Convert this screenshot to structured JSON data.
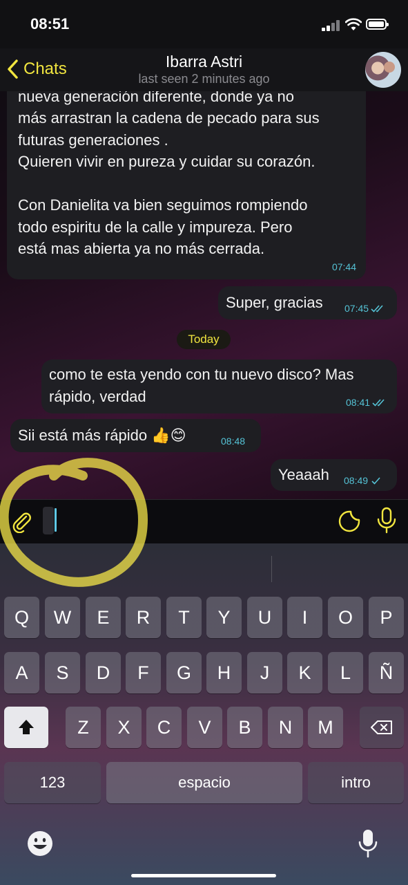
{
  "status": {
    "time": "08:51"
  },
  "header": {
    "back_label": "Chats",
    "title": "Ibarra Astri",
    "subtitle": "last seen 2 minutes ago"
  },
  "messages": [
    {
      "dir": "in",
      "text": "tocó lo que predicaste, quieran ser una\nnueva generación diferente, donde ya no\nmás arrastran la cadena de pecado para sus\nfuturas generaciones .\nQuieren vivir en pureza y cuidar su corazón.\n\nCon Danielita va bien seguimos rompiendo\ntodo espiritu de la calle y impureza. Pero\nestá mas abierta ya no más cerrada.",
      "time": "07:44"
    },
    {
      "dir": "out",
      "text": "Super, gracias",
      "time": "07:45",
      "read": true
    },
    {
      "dir": "out",
      "text": "como te esta yendo con tu nuevo disco? Mas\nrápido, verdad",
      "time": "08:41",
      "read": true
    },
    {
      "dir": "in",
      "text": "Sii está más rápido 👍😊",
      "time": "08:48"
    },
    {
      "dir": "out",
      "text": "Yeaaah",
      "time": "08:49",
      "read": false
    }
  ],
  "date_separator": "Today",
  "input": {
    "value": ""
  },
  "keyboard": {
    "row1": [
      "Q",
      "W",
      "E",
      "R",
      "T",
      "Y",
      "U",
      "I",
      "O",
      "P"
    ],
    "row2": [
      "A",
      "S",
      "D",
      "F",
      "G",
      "H",
      "J",
      "K",
      "L",
      "Ñ"
    ],
    "row3": [
      "Z",
      "X",
      "C",
      "V",
      "B",
      "N",
      "M"
    ],
    "numbers_label": "123",
    "space_label": "espacio",
    "return_label": "intro"
  },
  "icons": {
    "back": "chevron-left-icon",
    "attach": "paperclip-icon",
    "sticker": "sticker-icon",
    "mic": "microphone-icon",
    "shift": "shift-icon",
    "delete": "backspace-icon",
    "emoji": "emoji-icon",
    "dictation": "dictation-mic-icon"
  },
  "colors": {
    "accent": "#f1e53f",
    "time_text": "#55c3d6",
    "bubble": "#1f1f23"
  }
}
